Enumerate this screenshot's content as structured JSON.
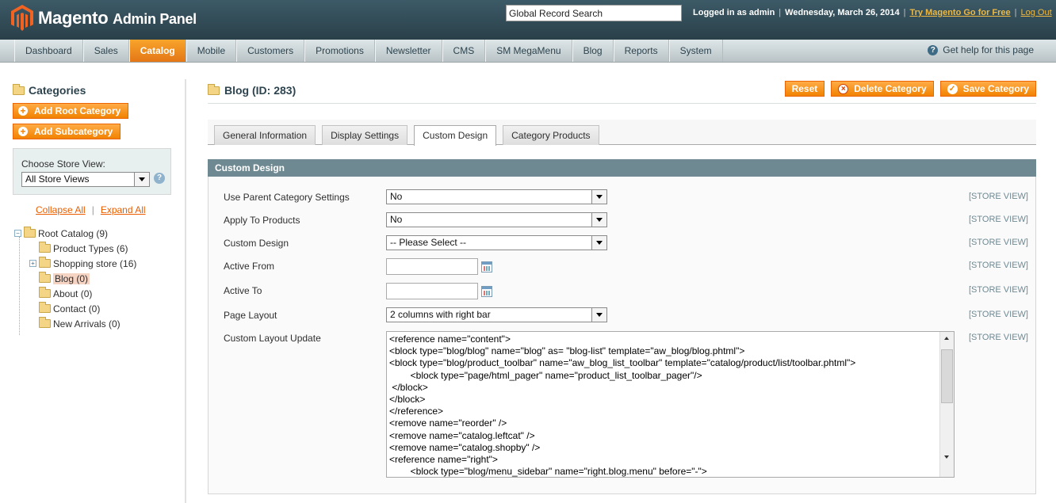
{
  "header": {
    "logo_text_brand": "Magento",
    "logo_text_product": "Admin Panel",
    "global_search_value": "Global Record Search",
    "logged_in": "Logged in as admin",
    "date": "Wednesday, March 26, 2014",
    "try_link": "Try Magento Go for Free",
    "logout_link": "Log Out"
  },
  "nav": {
    "items": [
      "Dashboard",
      "Sales",
      "Catalog",
      "Mobile",
      "Customers",
      "Promotions",
      "Newsletter",
      "CMS",
      "SM MegaMenu",
      "Blog",
      "Reports",
      "System"
    ],
    "active": "Catalog",
    "help": "Get help for this page"
  },
  "sidebar": {
    "title": "Categories",
    "add_root": "Add Root Category",
    "add_sub": "Add Subcategory",
    "store_view_label": "Choose Store View:",
    "store_view_value": "All Store Views",
    "collapse_all": "Collapse All",
    "expand_all": "Expand All",
    "tree": [
      {
        "label": "Root Catalog (9)",
        "level": 0,
        "toggle": "−"
      },
      {
        "label": "Product Types (6)",
        "level": 1,
        "toggle": ""
      },
      {
        "label": "Shopping store (16)",
        "level": 1,
        "toggle": "+"
      },
      {
        "label": "Blog (0)",
        "level": 1,
        "toggle": "",
        "selected": true
      },
      {
        "label": "About (0)",
        "level": 1,
        "toggle": ""
      },
      {
        "label": "Contact (0)",
        "level": 1,
        "toggle": ""
      },
      {
        "label": "New Arrivals (0)",
        "level": 1,
        "toggle": ""
      }
    ]
  },
  "main": {
    "title": "Blog (ID: 283)",
    "buttons": {
      "reset": "Reset",
      "delete": "Delete Category",
      "save": "Save Category"
    },
    "tabs": [
      "General Information",
      "Display Settings",
      "Custom Design",
      "Category Products"
    ],
    "active_tab": "Custom Design",
    "section_title": "Custom Design",
    "scope_label": "[STORE VIEW]",
    "fields": {
      "use_parent": {
        "label": "Use Parent Category Settings",
        "value": "No"
      },
      "apply_products": {
        "label": "Apply To Products",
        "value": "No"
      },
      "custom_design": {
        "label": "Custom Design",
        "value": "-- Please Select --"
      },
      "active_from": {
        "label": "Active From",
        "value": ""
      },
      "active_to": {
        "label": "Active To",
        "value": ""
      },
      "page_layout": {
        "label": "Page Layout",
        "value": "2 columns with right bar"
      },
      "layout_update": {
        "label": "Custom Layout Update"
      }
    },
    "layout_update_lines": [
      "<reference name=\"content\">",
      "<block type=\"blog/blog\" name=\"blog\" as= \"blog-list\" template=\"aw_blog/blog.phtml\">",
      "<block type=\"blog/product_toolbar\" name=\"aw_blog_list_toolbar\" template=\"catalog/product/list/toolbar.phtml\">",
      "        <block type=\"page/html_pager\" name=\"product_list_toolbar_pager\"/>",
      " </block>",
      "</block>",
      "</reference>",
      "<remove name=\"reorder\" />",
      "<remove name=\"catalog.leftcat\" />",
      "<remove name=\"catalog.shopby\" />",
      "<reference name=\"right\">",
      "        <block type=\"blog/menu_sidebar\" name=\"right.blog.menu\" before=\"-\">"
    ]
  }
}
